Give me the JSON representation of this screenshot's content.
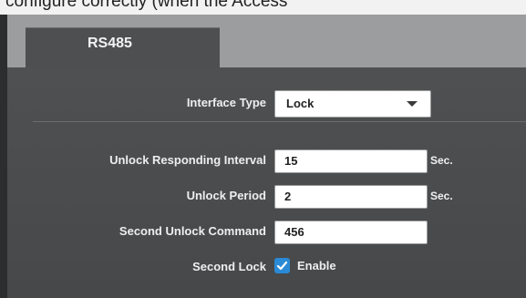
{
  "header": {
    "cut_text": "configure correctly (when the Access"
  },
  "tabs": [
    {
      "label": "RS485"
    }
  ],
  "form": {
    "interface_type": {
      "label": "Interface Type",
      "value": "Lock"
    },
    "unlock_interval": {
      "label": "Unlock Responding Interval",
      "value": "15",
      "unit": "Sec."
    },
    "unlock_period": {
      "label": "Unlock Period",
      "value": "2",
      "unit": "Sec."
    },
    "second_unlock_command": {
      "label": "Second Unlock Command",
      "value": "456"
    },
    "second_lock": {
      "label": "Second Lock",
      "checked": true,
      "option_label": "Enable"
    }
  },
  "colors": {
    "accent": "#2a8ad6",
    "panel_bg": "#4a4c4e",
    "tab_bar": "#9b9d9f"
  },
  "icons": {
    "dropdown": "chevron-down-icon",
    "check": "check-icon"
  }
}
